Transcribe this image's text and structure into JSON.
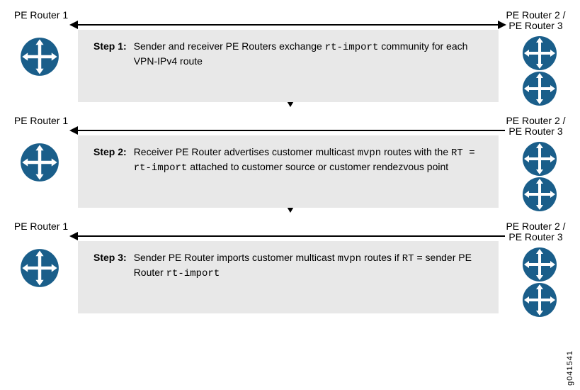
{
  "labels": {
    "left": "PE Router 1",
    "right": "PE Router 2 / PE Router 3"
  },
  "steps": [
    {
      "arrow": "bi",
      "label": "Step 1:",
      "parts": [
        {
          "t": "Sender and receiver PE Routers exchange ",
          "m": false
        },
        {
          "t": "rt-import",
          "m": true
        },
        {
          "t": " community for each VPN-IPv4 route",
          "m": false
        }
      ]
    },
    {
      "arrow": "left",
      "label": "Step 2:",
      "parts": [
        {
          "t": "Receiver PE Router advertises customer multicast ",
          "m": false
        },
        {
          "t": "mvpn",
          "m": true
        },
        {
          "t": " routes with the ",
          "m": false
        },
        {
          "t": "RT = rt-import",
          "m": true
        },
        {
          "t": " attached to customer source or customer rendezvous point",
          "m": false
        }
      ]
    },
    {
      "arrow": "left",
      "label": "Step 3:",
      "parts": [
        {
          "t": "Sender PE Router imports customer multicast ",
          "m": false
        },
        {
          "t": "mvpn",
          "m": true
        },
        {
          "t": " routes if ",
          "m": false
        },
        {
          "t": "RT",
          "m": true
        },
        {
          "t": " = sender PE Router ",
          "m": false
        },
        {
          "t": "rt-import",
          "m": true
        }
      ]
    }
  ],
  "figure_id": "g041541",
  "icon_color": "#1a5e8a"
}
